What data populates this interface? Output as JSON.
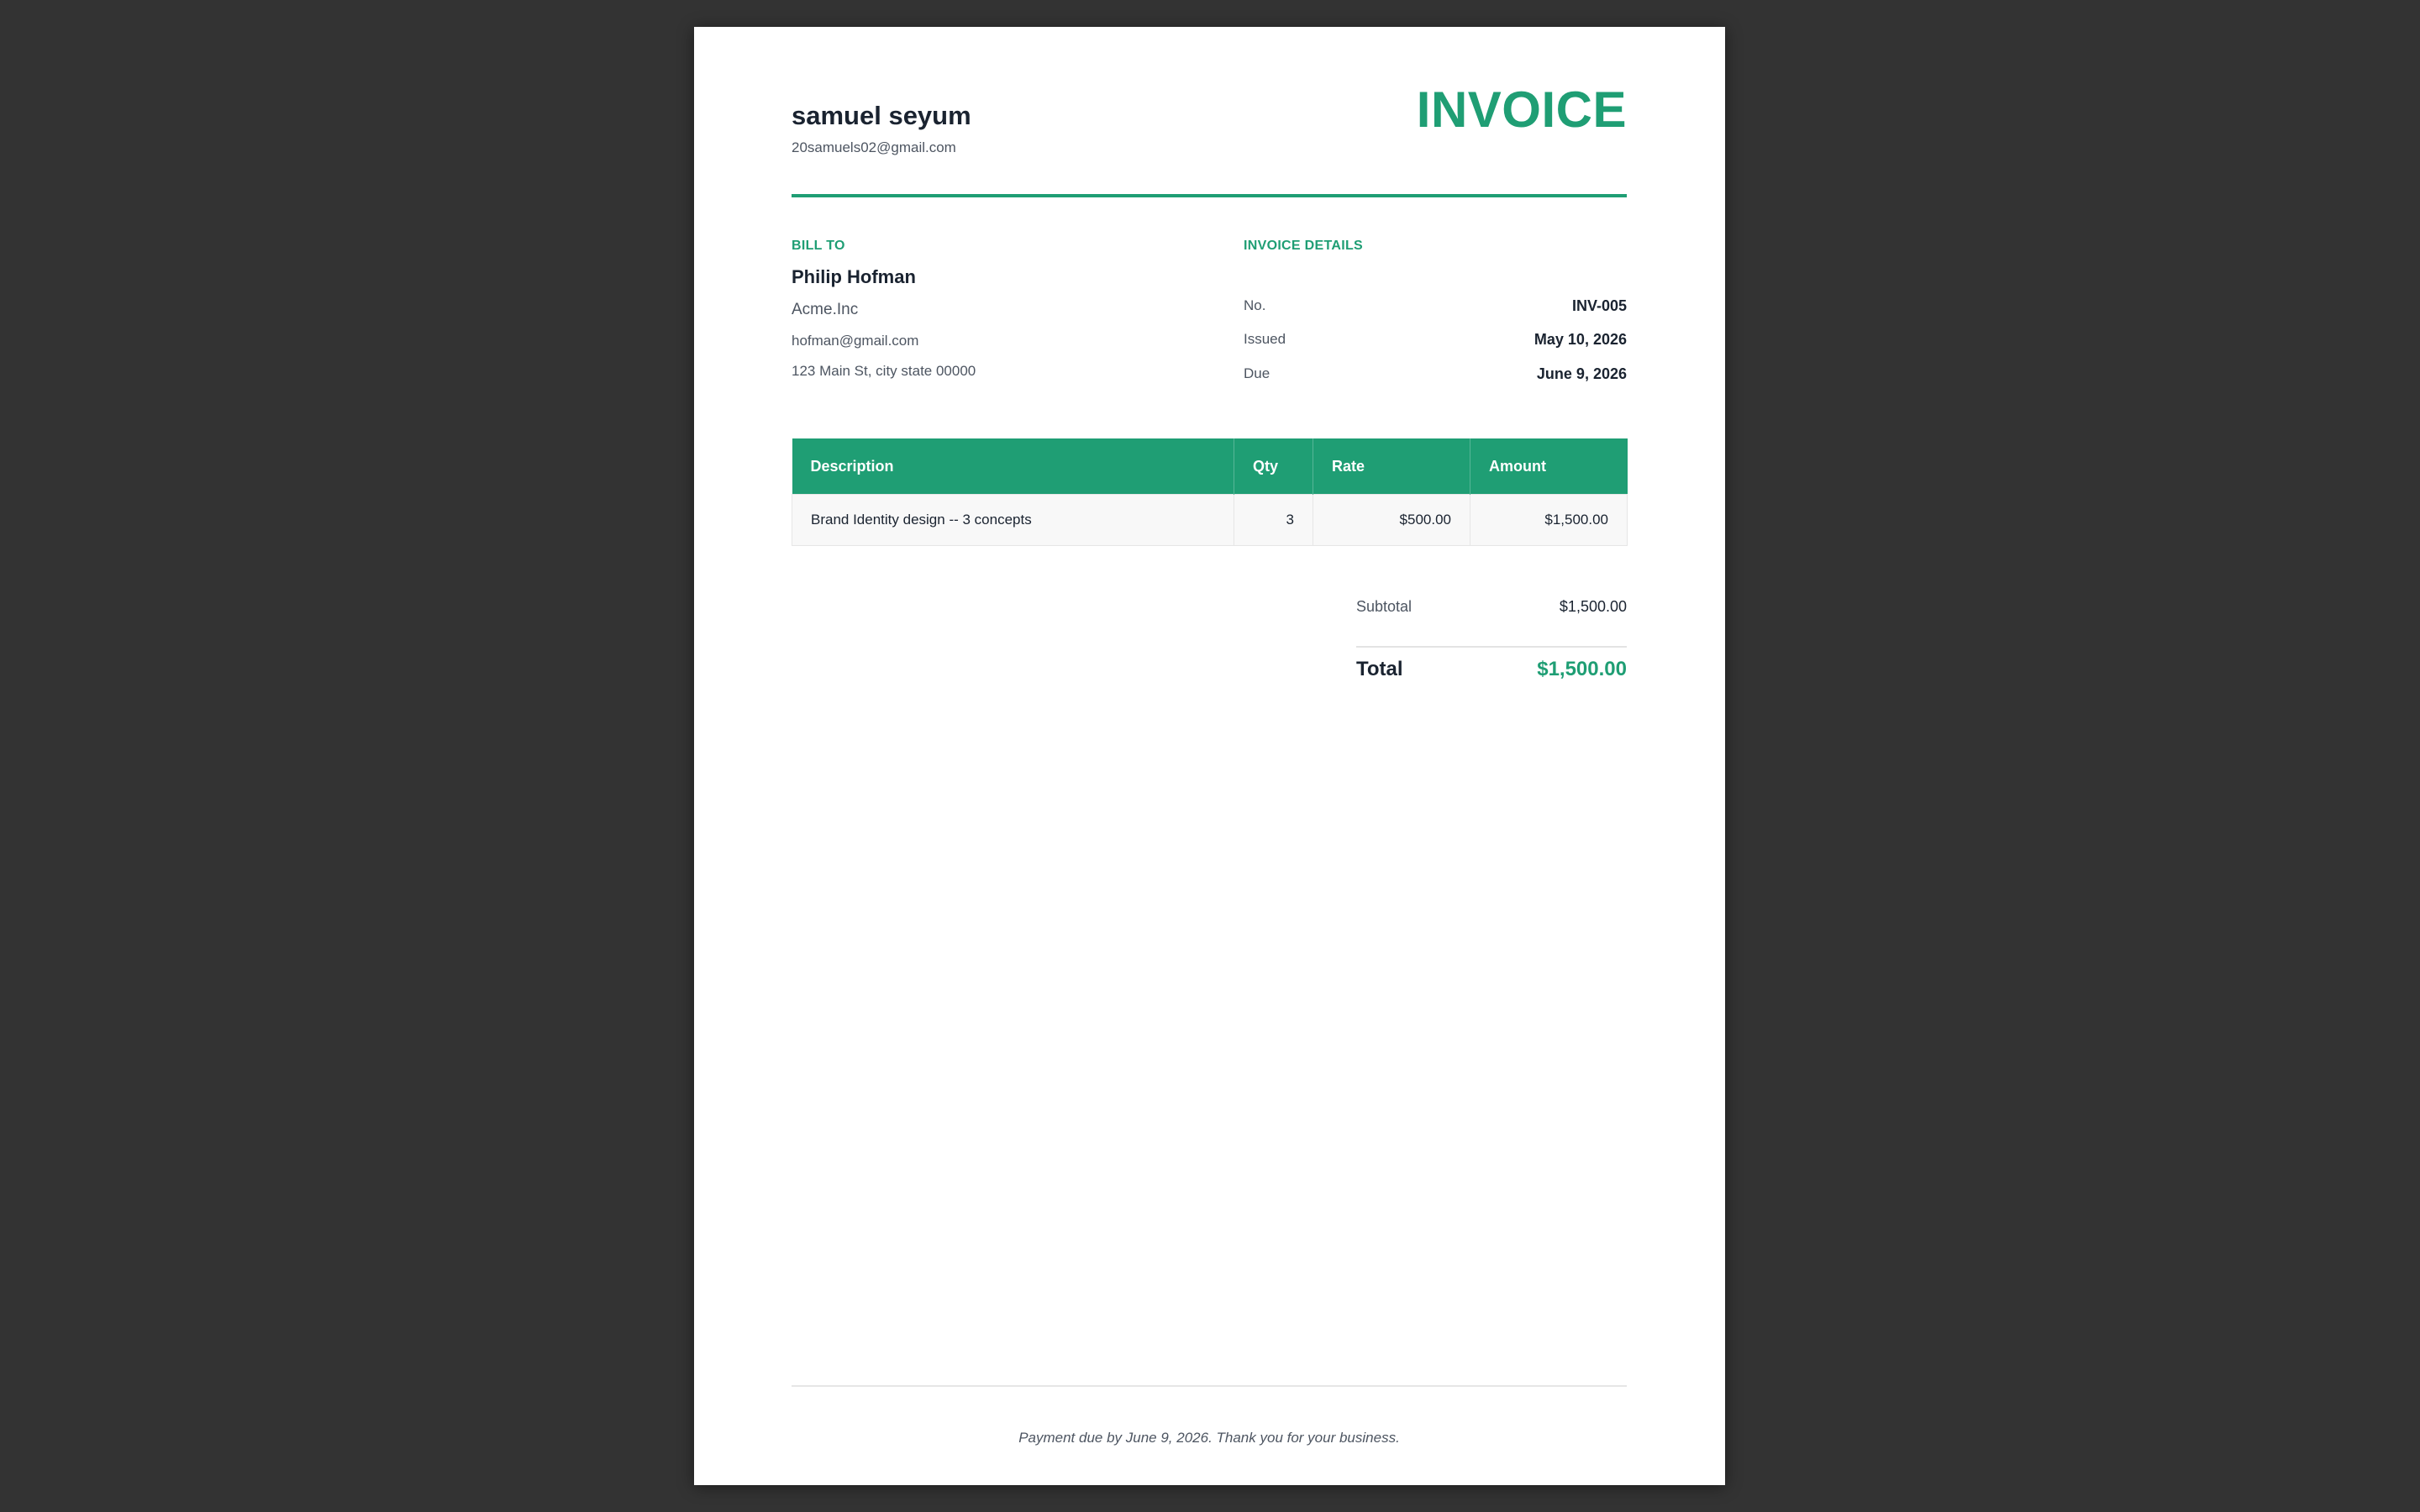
{
  "colors": {
    "accent": "#1f9e74",
    "backdrop": "#333333",
    "paper": "#ffffff",
    "text_dark": "#1a2330",
    "text_muted": "#4d5561"
  },
  "sender": {
    "name": "samuel seyum",
    "email": "20samuels02@gmail.com"
  },
  "document": {
    "title": "INVOICE"
  },
  "bill_to": {
    "label": "BILL TO",
    "name": "Philip Hofman",
    "company": "Acme.Inc",
    "email": "hofman@gmail.com",
    "address": "123 Main St, city state 00000"
  },
  "details": {
    "label": "INVOICE DETAILS",
    "rows": [
      {
        "label": "No.",
        "value": "INV-005"
      },
      {
        "label": "Issued",
        "value": "May 10, 2026"
      },
      {
        "label": "Due",
        "value": "June 9, 2026"
      }
    ]
  },
  "table": {
    "headers": [
      "Description",
      "Qty",
      "Rate",
      "Amount"
    ],
    "rows": [
      {
        "description": "Brand Identity design -- 3 concepts",
        "qty": "3",
        "rate": "$500.00",
        "amount": "$1,500.00"
      }
    ]
  },
  "summary": {
    "subtotal_label": "Subtotal",
    "subtotal_value": "$1,500.00",
    "total_label": "Total",
    "total_value": "$1,500.00"
  },
  "footer": {
    "note": "Payment due by June 9, 2026. Thank you for your business."
  }
}
